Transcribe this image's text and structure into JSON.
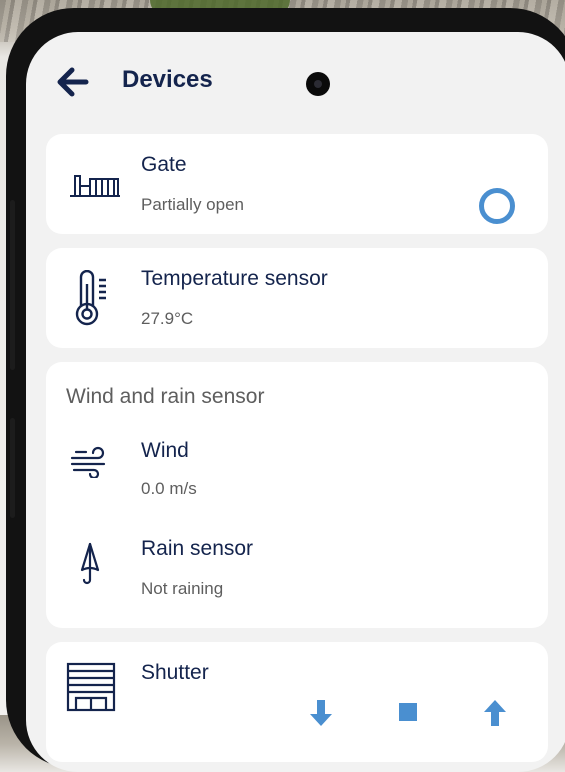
{
  "header": {
    "title": "Devices"
  },
  "devices": {
    "gate": {
      "name": "Gate",
      "status": "Partially open"
    },
    "temperature": {
      "name": "Temperature sensor",
      "status": "27.9°C"
    },
    "wind_rain": {
      "section_title": "Wind and rain sensor",
      "wind": {
        "name": "Wind",
        "status": "0.0 m/s"
      },
      "rain": {
        "name": "Rain sensor",
        "status": "Not raining"
      }
    },
    "shutter": {
      "name": "Shutter"
    }
  },
  "icons": {
    "back": "arrow-left-icon",
    "gate": "gate-icon",
    "gate_state": "ring-icon",
    "temperature": "thermometer-icon",
    "wind": "wind-icon",
    "rain": "umbrella-icon",
    "shutter": "shutter-icon",
    "shutter_down": "arrow-down-icon",
    "shutter_stop": "stop-icon",
    "shutter_up": "arrow-up-icon"
  },
  "colors": {
    "primary_text": "#14244d",
    "secondary_text": "#5e5e5e",
    "accent": "#4a8fd0",
    "card": "#ffffff",
    "screen": "#f2f2f2"
  }
}
